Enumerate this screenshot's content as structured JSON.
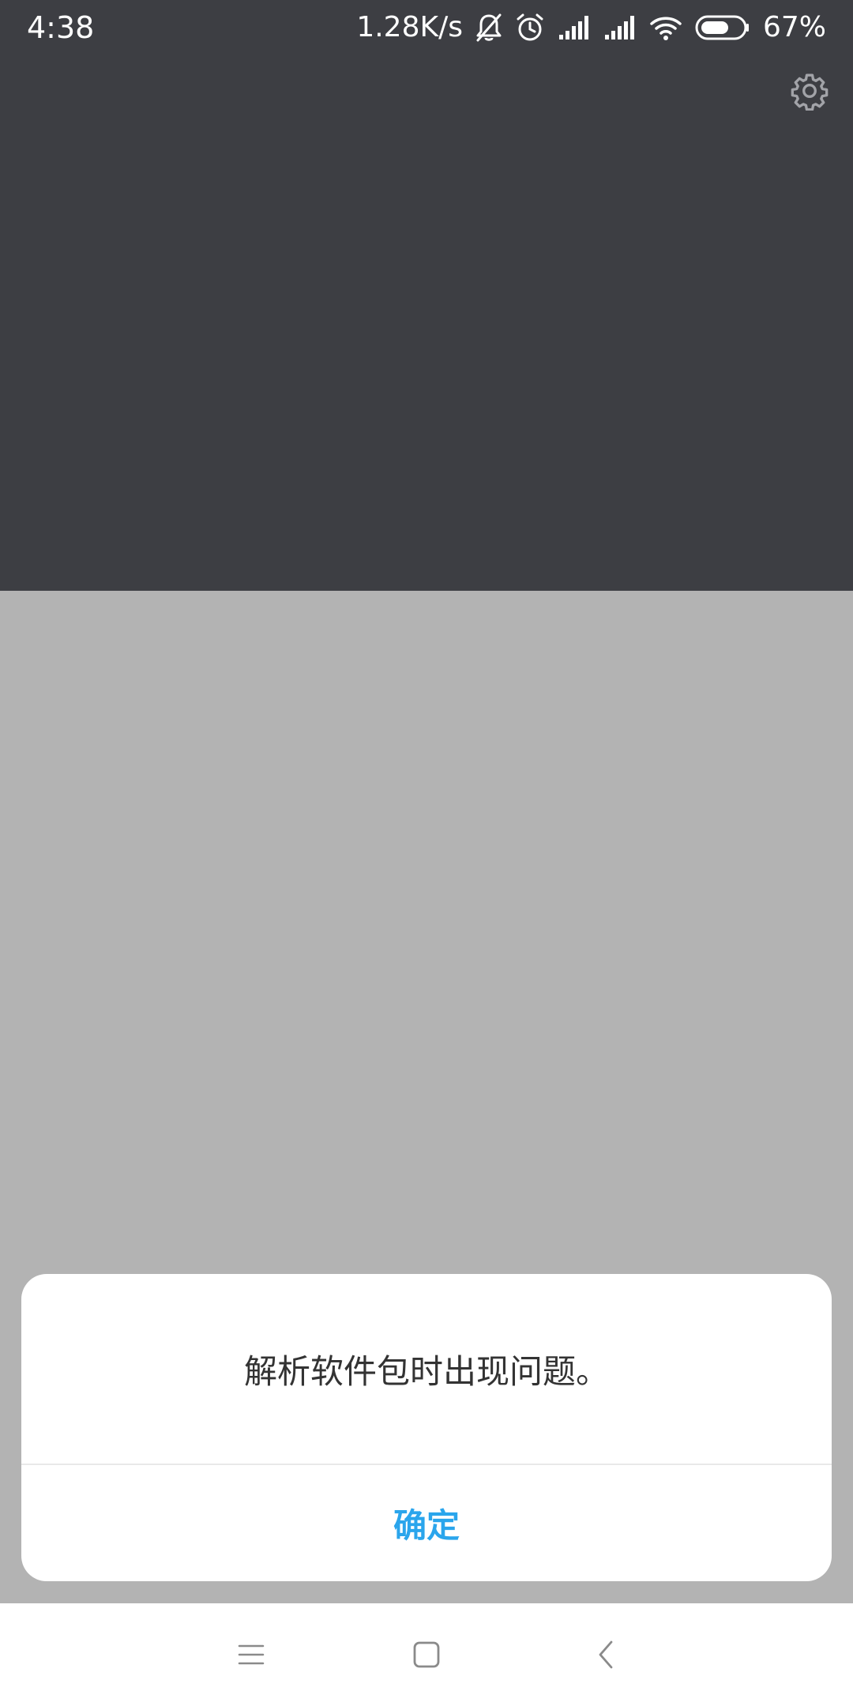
{
  "status_bar": {
    "time": "4:38",
    "network_speed": "1.28K/s",
    "battery_percent": "67%",
    "battery_level": 0.67,
    "icons": [
      "bell-off-icon",
      "alarm-icon",
      "signal-1-icon",
      "signal-2-icon",
      "wifi-icon",
      "battery-icon"
    ]
  },
  "header": {
    "settings_icon": "gear-icon"
  },
  "dialog": {
    "message": "解析软件包时出现问题。",
    "confirm_label": "确定"
  },
  "nav_bar": {
    "icons": [
      "menu-icon",
      "home-icon",
      "back-icon"
    ]
  },
  "colors": {
    "top_background": "#3d3e43",
    "overlay_background": "#b3b3b3",
    "dialog_background": "#ffffff",
    "accent": "#2aa5ec"
  }
}
